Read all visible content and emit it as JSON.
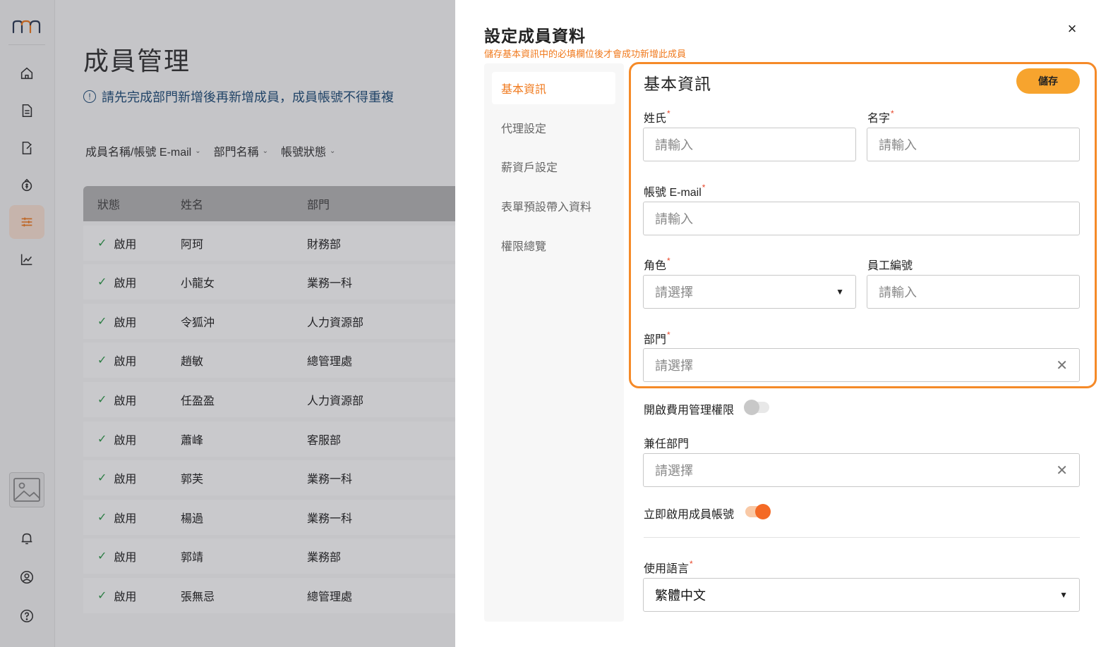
{
  "nav": {
    "logo": "logo-icon",
    "items": [
      {
        "icon": "home-icon"
      },
      {
        "icon": "document-icon"
      },
      {
        "icon": "file-edit-icon"
      },
      {
        "icon": "money-icon"
      },
      {
        "icon": "settings-sliders-icon",
        "active": true
      },
      {
        "icon": "chart-icon"
      }
    ],
    "bottom": [
      {
        "icon": "image-placeholder-icon"
      },
      {
        "icon": "bell-icon"
      },
      {
        "icon": "user-circle-icon"
      },
      {
        "icon": "help-icon"
      }
    ]
  },
  "main": {
    "title": "成員管理",
    "notice": "請先完成部門新增後再新增成員，成員帳號不得重複",
    "filters": [
      "成員名稱/帳號 E-mail",
      "部門名稱",
      "帳號狀態"
    ],
    "columns": [
      "狀態",
      "姓名",
      "部門"
    ],
    "rows": [
      {
        "status": "啟用",
        "name": "阿珂",
        "dept": "財務部"
      },
      {
        "status": "啟用",
        "name": "小龍女",
        "dept": "業務一科"
      },
      {
        "status": "啟用",
        "name": "令狐沖",
        "dept": "人力資源部"
      },
      {
        "status": "啟用",
        "name": "趙敏",
        "dept": "總管理處"
      },
      {
        "status": "啟用",
        "name": "任盈盈",
        "dept": "人力資源部"
      },
      {
        "status": "啟用",
        "name": "蕭峰",
        "dept": "客服部"
      },
      {
        "status": "啟用",
        "name": "郭芙",
        "dept": "業務一科"
      },
      {
        "status": "啟用",
        "name": "楊過",
        "dept": "業務一科"
      },
      {
        "status": "啟用",
        "name": "郭靖",
        "dept": "業務部"
      },
      {
        "status": "啟用",
        "name": "張無忌",
        "dept": "總管理處"
      }
    ]
  },
  "drawer": {
    "title": "設定成員資料",
    "subtitle": "儲存基本資訊中的必填欄位後才會成功新增此成員",
    "close": "×",
    "tabs": [
      "基本資訊",
      "代理設定",
      "薪資戶設定",
      "表單預設帶入資料",
      "權限總覽"
    ],
    "section_title": "基本資訊",
    "save_label": "儲存",
    "fields": {
      "last_name": {
        "label": "姓氏",
        "placeholder": "請輸入"
      },
      "first_name": {
        "label": "名字",
        "placeholder": "請輸入"
      },
      "email": {
        "label": "帳號 E-mail",
        "placeholder": "請輸入"
      },
      "role": {
        "label": "角色",
        "placeholder": "請選擇"
      },
      "employee_id": {
        "label": "員工編號",
        "placeholder": "請輸入"
      },
      "department": {
        "label": "部門",
        "placeholder": "請選擇"
      },
      "expense_admin": {
        "label": "開啟費用管理權限",
        "on": false
      },
      "concurrent_dept": {
        "label": "兼任部門",
        "placeholder": "請選擇"
      },
      "activate_now": {
        "label": "立即啟用成員帳號",
        "on": true
      },
      "language": {
        "label": "使用語言",
        "value": "繁體中文"
      }
    },
    "required_mark": "*",
    "colors": {
      "accent": "#f58a28",
      "save": "#f7a42e",
      "toggle_on": "#f46a26"
    }
  }
}
